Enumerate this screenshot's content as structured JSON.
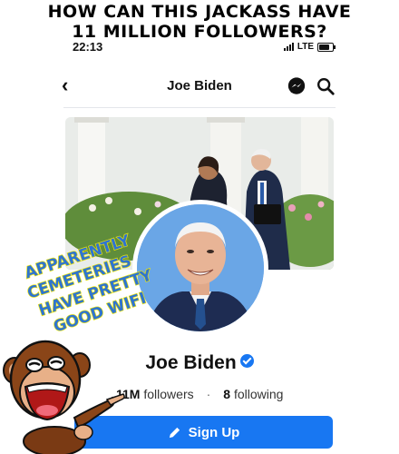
{
  "meme": {
    "caption_line1": "HOW CAN THIS JACKASS HAVE",
    "caption_line2": "11 MILLION FOLLOWERS?",
    "overlay_text": [
      "APPARENTLY",
      "CEMETERIES",
      "HAVE PRETTY",
      "GOOD WIFI"
    ]
  },
  "status_bar": {
    "time": "22:13",
    "network": "LTE"
  },
  "nav": {
    "title": "Joe Biden",
    "icons": [
      "back-chevron-icon",
      "messenger-icon",
      "search-icon"
    ]
  },
  "profile": {
    "name": "Joe Biden",
    "verified": true,
    "followers_count": "11M",
    "followers_label": "followers",
    "following_count": "8",
    "following_label": "following",
    "separator": "·"
  },
  "actions": {
    "signup_label": "Sign Up"
  },
  "colors": {
    "accent": "#1877f2",
    "overlay_text_fill": "#2f74d0",
    "overlay_text_stroke": "#f2e600"
  }
}
